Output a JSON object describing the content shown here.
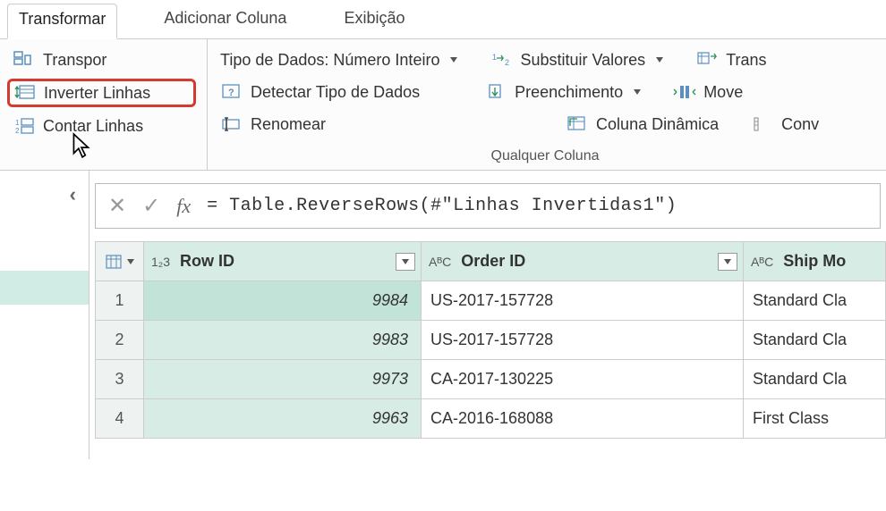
{
  "tabs": {
    "transform": "Transformar",
    "add_column": "Adicionar Coluna",
    "view": "Exibição"
  },
  "ribbon": {
    "group1": {
      "transpose": "Transpor",
      "reverse_rows": "Inverter Linhas",
      "count_rows": "Contar Linhas"
    },
    "group2": {
      "data_type": "Tipo de Dados: Número Inteiro",
      "detect_type": "Detectar Tipo de Dados",
      "rename": "Renomear",
      "replace_values": "Substituir Valores",
      "fill": "Preenchimento",
      "pivot": "Coluna Dinâmica",
      "transpose_col": "Trans",
      "move": "Move",
      "convert": "Conv",
      "group_label": "Qualquer Coluna"
    }
  },
  "formula": {
    "text": "= Table.ReverseRows(#\"Linhas Invertidas1\")"
  },
  "table": {
    "corner_icon": "table-icon",
    "columns": [
      {
        "type_label": "1₂3",
        "name": "Row ID"
      },
      {
        "type_label": "AᴮC",
        "name": "Order ID"
      },
      {
        "type_label": "AᴮC",
        "name": "Ship Mo"
      }
    ],
    "rows": [
      {
        "idx": "1",
        "row_id": "9984",
        "order_id": "US-2017-157728",
        "ship": "Standard Cla"
      },
      {
        "idx": "2",
        "row_id": "9983",
        "order_id": "US-2017-157728",
        "ship": "Standard Cla"
      },
      {
        "idx": "3",
        "row_id": "9973",
        "order_id": "CA-2017-130225",
        "ship": "Standard Cla"
      },
      {
        "idx": "4",
        "row_id": "9963",
        "order_id": "CA-2016-168088",
        "ship": "First Class"
      }
    ]
  }
}
